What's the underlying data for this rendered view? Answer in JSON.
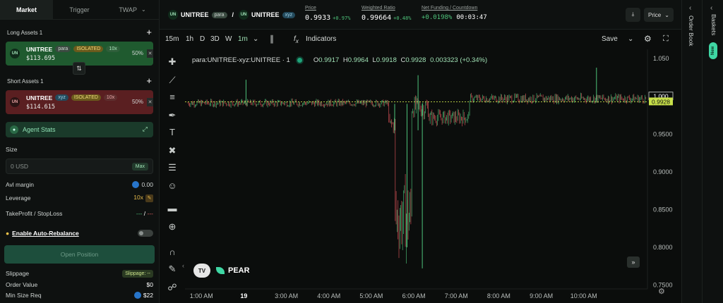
{
  "order_panel": {
    "tabs": [
      "Market",
      "Trigger",
      "TWAP"
    ],
    "long_assets_label": "Long Assets 1",
    "short_assets_label": "Short Assets 1",
    "long_asset": {
      "icon": "UN",
      "name": "UNITREE",
      "venue": "para",
      "margin": "ISOLATED",
      "leverage": "10x",
      "price": "$113.695",
      "weight": "50%"
    },
    "short_asset": {
      "icon": "UN",
      "name": "UNITREE",
      "venue": "xyz",
      "margin": "ISOLATED",
      "leverage": "10x",
      "price": "$114.615",
      "weight": "50%"
    },
    "agent_stats": "Agent Stats",
    "size_label": "Size",
    "size_placeholder": "0 USD",
    "max_label": "Max",
    "avl_margin_label": "Avl margin",
    "avl_margin_value": "0.00",
    "leverage_label": "Leverage",
    "leverage_value": "10x",
    "tpsl_label": "TakeProfit / StopLoss",
    "tpsl_long": "---",
    "tpsl_sep": "/",
    "tpsl_short": "---",
    "auto_rebalance_label": "Enable Auto-Rebalance",
    "open_position_label": "Open Position",
    "slippage_label": "Slippage",
    "slippage_value": "Slippage: --",
    "order_value_label": "Order Value",
    "order_value": "$0",
    "min_size_label": "Min Size Req",
    "min_size_value": "$22"
  },
  "header": {
    "long_token": "UNITREE",
    "long_venue": "para",
    "sep": "/",
    "short_token": "UNITREE",
    "short_venue": "xyz",
    "token_icon": "UN",
    "price_label": "Price",
    "price": "0.9933",
    "price_change": "+0.97%",
    "ratio_label": "Weighted Ratio",
    "ratio": "0.99664",
    "ratio_change": "+0.48%",
    "funding_label": "Net Funding / Countdown",
    "funding": "+0.0198%",
    "countdown": "00:03:47",
    "price_button": "Price"
  },
  "toolbar": {
    "intervals": [
      "15m",
      "1h",
      "D",
      "3D",
      "W",
      "1m"
    ],
    "indicators": "Indicators",
    "save": "Save"
  },
  "chart_legend": {
    "symbol": "para:UNITREE-xyz:UNITREE · 1",
    "o_label": "O",
    "o": "0.9917",
    "h_label": "H",
    "h": "0.9964",
    "l_label": "L",
    "l": "0.9918",
    "c_label": "C",
    "c": "0.9928",
    "change": "0.003323 (+0.34%)"
  },
  "chart_data": {
    "type": "candlestick",
    "yticks": [
      "1.050",
      "0.9500",
      "0.9000",
      "0.8500",
      "0.8000",
      "0.7500"
    ],
    "ylim": [
      0.7448,
      1.0623
    ],
    "xticks": [
      "1:00 AM",
      "19",
      "3:00 AM",
      "4:00 AM",
      "5:00 AM",
      "6:00 AM",
      "7:00 AM",
      "8:00 AM",
      "9:00 AM",
      "10:00 AM"
    ],
    "xtick_hours": [
      1,
      2,
      3,
      4,
      5,
      6,
      7,
      8,
      9,
      10
    ],
    "xlim_hours": [
      0.68,
      11.5
    ],
    "reference_price": "1.000",
    "last_price": "0.9928",
    "segments": [
      {
        "from": 0.68,
        "to": 5.4,
        "level": 0.991,
        "noise": 0.004
      },
      {
        "from": 5.4,
        "to": 5.55,
        "level": 0.9625,
        "noise": 0.01
      },
      {
        "from": 5.55,
        "to": 5.95,
        "level": 0.84,
        "noise": 0.04
      },
      {
        "from": 5.95,
        "to": 6.35,
        "level": 0.985,
        "noise": 0.012
      },
      {
        "from": 6.35,
        "to": 7.3,
        "level": 0.972,
        "noise": 0.008
      },
      {
        "from": 7.3,
        "to": 11.5,
        "level": 0.997,
        "noise": 0.005
      }
    ],
    "spikes": [
      {
        "t": 2.05,
        "high": 1.022,
        "low": 0.988
      },
      {
        "t": 5.55,
        "high": 0.99,
        "low": 0.955
      },
      {
        "t": 5.84,
        "high": 0.99,
        "low": 0.8
      },
      {
        "t": 6.1,
        "high": 1.028,
        "low": 0.955
      },
      {
        "t": 6.2,
        "high": 0.99,
        "low": 0.772
      },
      {
        "t": 10.3,
        "high": 1.038,
        "low": 0.992
      }
    ]
  },
  "brand": {
    "tv": "TV",
    "name": "PEAR"
  },
  "right_panel": {
    "order_book": "Order Book",
    "baskets": "Baskets",
    "new_badge": "New"
  },
  "colors": {
    "up": "#4ec27a",
    "down": "#e0555a",
    "accent": "#3fd7a4",
    "ref": "#c8e04a"
  }
}
